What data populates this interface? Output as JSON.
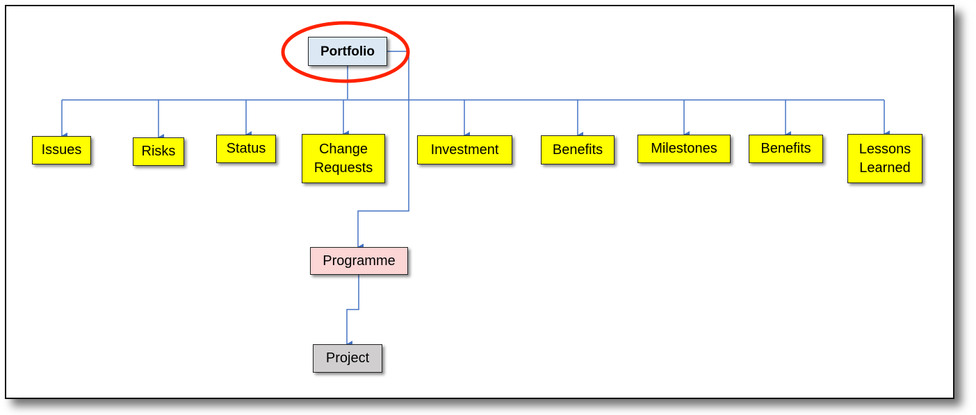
{
  "colors": {
    "connector": "#4472c4",
    "highlight": "#ff2200",
    "leaf": "#ffff00",
    "portfolio": "#dce9f5",
    "programme": "#fcd5d5",
    "project": "#d0cece"
  },
  "root": {
    "label": "Portfolio",
    "highlighted": true
  },
  "children": [
    {
      "label": "Issues"
    },
    {
      "label": "Risks"
    },
    {
      "label": "Status"
    },
    {
      "label": "Change Requests"
    },
    {
      "label": "Investment"
    },
    {
      "label": "Benefits"
    },
    {
      "label": "Milestones"
    },
    {
      "label": "Benefits"
    },
    {
      "label": "Lessons Learned"
    }
  ],
  "programme": {
    "label": "Programme"
  },
  "project": {
    "label": "Project"
  }
}
